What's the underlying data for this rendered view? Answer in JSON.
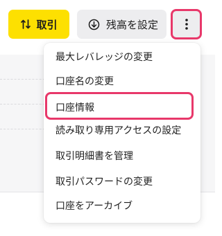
{
  "toolbar": {
    "trade_label": "取引",
    "trade_icon": "arrows-exchange-icon",
    "balance_label": "残高を設定",
    "balance_icon": "circle-arrow-down-icon",
    "more_icon": "vertical-ellipsis-icon"
  },
  "menu": {
    "items": [
      {
        "label": "最大レバレッジの変更"
      },
      {
        "label": "口座名の変更"
      },
      {
        "label": "口座情報"
      },
      {
        "label": "読み取り専用アクセスの設定"
      },
      {
        "label": "取引明細書を管理"
      },
      {
        "label": "取引パスワードの変更"
      },
      {
        "label": "口座をアーカイブ"
      }
    ],
    "highlighted_label": "口座情報"
  },
  "colors": {
    "accent_yellow": "#fde001",
    "highlight_pink": "#e8386a",
    "button_gray": "#ededef"
  }
}
